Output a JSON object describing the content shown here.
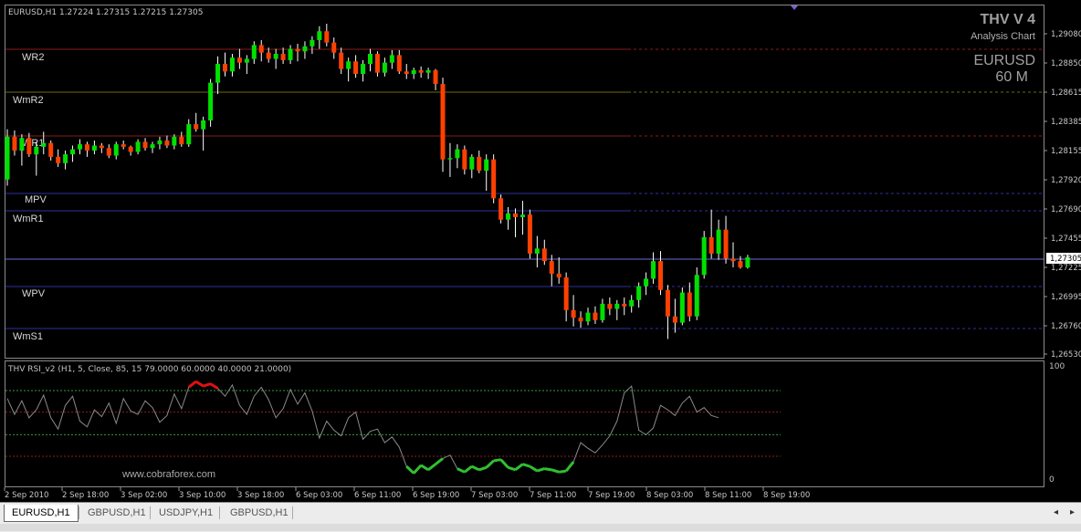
{
  "symbol_header": "EURUSD,H1  1.27224 1.27315 1.27215 1.27305",
  "brand": {
    "title": "THV V 4",
    "subtitle": "Analysis Chart",
    "symbol": "EURUSD",
    "timeframe": "60 M"
  },
  "pivot_labels": [
    "WR2",
    "WmR2",
    "WR1",
    "MPV",
    "WmR1",
    "WPV",
    "WmS1"
  ],
  "indicator": {
    "label": "THV RSI_v2  (H1,  5,  Close,  85,  15 79.0000 60.0000 40.0000 21.0000)",
    "scale_top": "100",
    "scale_bottom": "0",
    "levels": [
      79,
      60,
      40,
      21
    ],
    "watermark": "www.cobraforex.com"
  },
  "price_scale": [
    "1,29080",
    "1,28850",
    "1,28615",
    "1,28385",
    "1,28155",
    "1,27920",
    "1,27690",
    "1,27455",
    "1,27225",
    "1,26995",
    "1,26760",
    "1,26530"
  ],
  "current_price": "1,27305",
  "time_labels": [
    "2 Sep 2010",
    "2 Sep 18:00",
    "3 Sep 02:00",
    "3 Sep 10:00",
    "3 Sep 18:00",
    "6 Sep 03:00",
    "6 Sep 11:00",
    "6 Sep 19:00",
    "7 Sep 03:00",
    "7 Sep 11:00",
    "7 Sep 19:00",
    "8 Sep 03:00",
    "8 Sep 11:00",
    "8 Sep 19:00"
  ],
  "tabs": [
    {
      "label": "EURUSD,H1",
      "active": true
    },
    {
      "label": "GBPUSD,H1",
      "active": false
    },
    {
      "label": "USDJPY,H1",
      "active": false
    },
    {
      "label": "GBPUSD,H1",
      "active": false
    }
  ],
  "colors": {
    "bull": "#00e000",
    "bear": "#ff4000",
    "wick": "#ffffff",
    "axis": "#9a9a9a",
    "pivot_red": "#8b1a1a",
    "pivot_olive": "#6b6b10",
    "pivot_blue": "#3030a0",
    "rsi_line": "#8a8a8a",
    "rsi_hot": "#e01010",
    "rsi_cold": "#30c030"
  },
  "chart_data": {
    "type": "candlestick",
    "series": [
      {
        "name": "EURUSD,H1",
        "ohlc": [
          [
            1.2792,
            1.2832,
            1.2787,
            1.2826
          ],
          [
            1.2826,
            1.2831,
            1.2811,
            1.2815
          ],
          [
            1.2815,
            1.2828,
            1.2803,
            1.2825
          ],
          [
            1.2825,
            1.2829,
            1.281,
            1.2812
          ],
          [
            1.2812,
            1.2822,
            1.2795,
            1.2818
          ],
          [
            1.2818,
            1.283,
            1.2812,
            1.2821
          ],
          [
            1.2821,
            1.2823,
            1.2807,
            1.281
          ],
          [
            1.281,
            1.2816,
            1.2802,
            1.2805
          ],
          [
            1.2805,
            1.2815,
            1.28,
            1.2812
          ],
          [
            1.2812,
            1.2819,
            1.2806,
            1.2816
          ],
          [
            1.2816,
            1.2824,
            1.2812,
            1.282
          ],
          [
            1.282,
            1.2822,
            1.281,
            1.2815
          ],
          [
            1.2815,
            1.2823,
            1.2812,
            1.2819
          ],
          [
            1.2819,
            1.2821,
            1.2813,
            1.2817
          ],
          [
            1.2817,
            1.282,
            1.2809,
            1.2811
          ],
          [
            1.2811,
            1.2822,
            1.2808,
            1.282
          ],
          [
            1.282,
            1.2823,
            1.2816,
            1.2818
          ],
          [
            1.2818,
            1.2819,
            1.2811,
            1.2814
          ],
          [
            1.2814,
            1.2824,
            1.2812,
            1.2822
          ],
          [
            1.2822,
            1.2825,
            1.2815,
            1.2817
          ],
          [
            1.2817,
            1.2822,
            1.2813,
            1.282
          ],
          [
            1.282,
            1.2826,
            1.2816,
            1.2823
          ],
          [
            1.2823,
            1.2827,
            1.2817,
            1.2819
          ],
          [
            1.2819,
            1.2828,
            1.2816,
            1.2826
          ],
          [
            1.2826,
            1.283,
            1.2818,
            1.282
          ],
          [
            1.282,
            1.284,
            1.2818,
            1.2836
          ],
          [
            1.2836,
            1.2845,
            1.283,
            1.2832
          ],
          [
            1.2832,
            1.2842,
            1.2815,
            1.2839
          ],
          [
            1.2839,
            1.2872,
            1.2834,
            1.2869
          ],
          [
            1.2869,
            1.289,
            1.286,
            1.2884
          ],
          [
            1.2884,
            1.2893,
            1.2874,
            1.2878
          ],
          [
            1.2878,
            1.2892,
            1.2874,
            1.2889
          ],
          [
            1.2889,
            1.2896,
            1.288,
            1.2885
          ],
          [
            1.2885,
            1.2891,
            1.2876,
            1.2888
          ],
          [
            1.2888,
            1.2902,
            1.2884,
            1.2899
          ],
          [
            1.2899,
            1.2903,
            1.2886,
            1.2893
          ],
          [
            1.2893,
            1.2897,
            1.2885,
            1.2888
          ],
          [
            1.2888,
            1.2896,
            1.288,
            1.2892
          ],
          [
            1.2892,
            1.2897,
            1.2884,
            1.2887
          ],
          [
            1.2887,
            1.2899,
            1.2884,
            1.2896
          ],
          [
            1.2896,
            1.29,
            1.2886,
            1.2894
          ],
          [
            1.2894,
            1.2902,
            1.2888,
            1.2898
          ],
          [
            1.2898,
            1.2906,
            1.2892,
            1.2903
          ],
          [
            1.2903,
            1.2914,
            1.2896,
            1.291
          ],
          [
            1.291,
            1.2916,
            1.2898,
            1.2901
          ],
          [
            1.2901,
            1.2905,
            1.2888,
            1.2893
          ],
          [
            1.2893,
            1.2897,
            1.2876,
            1.288
          ],
          [
            1.288,
            1.2889,
            1.287,
            1.2886
          ],
          [
            1.2886,
            1.2891,
            1.2873,
            1.2876
          ],
          [
            1.2876,
            1.2887,
            1.287,
            1.2884
          ],
          [
            1.2884,
            1.2896,
            1.2878,
            1.2892
          ],
          [
            1.2892,
            1.2894,
            1.2874,
            1.2877
          ],
          [
            1.2877,
            1.2889,
            1.2874,
            1.2885
          ],
          [
            1.2885,
            1.2895,
            1.288,
            1.2891
          ],
          [
            1.2891,
            1.2895,
            1.2876,
            1.2878
          ],
          [
            1.2878,
            1.2884,
            1.2872,
            1.2876
          ],
          [
            1.2876,
            1.2881,
            1.2872,
            1.2879
          ],
          [
            1.2879,
            1.2882,
            1.2873,
            1.2877
          ],
          [
            1.2877,
            1.2881,
            1.2872,
            1.2879
          ],
          [
            1.2879,
            1.288,
            1.2863,
            1.2868
          ],
          [
            1.2868,
            1.2873,
            1.2798,
            1.2808
          ],
          [
            1.2808,
            1.2821,
            1.2794,
            1.2809
          ],
          [
            1.2809,
            1.282,
            1.2801,
            1.2816
          ],
          [
            1.2816,
            1.2819,
            1.2796,
            1.28
          ],
          [
            1.28,
            1.2812,
            1.2793,
            1.281
          ],
          [
            1.281,
            1.2815,
            1.2797,
            1.2799
          ],
          [
            1.2799,
            1.2812,
            1.2783,
            1.2808
          ],
          [
            1.2808,
            1.2812,
            1.2773,
            1.2777
          ],
          [
            1.2777,
            1.278,
            1.2757,
            1.276
          ],
          [
            1.276,
            1.277,
            1.2752,
            1.2765
          ],
          [
            1.2765,
            1.2769,
            1.2746,
            1.2762
          ],
          [
            1.2762,
            1.2775,
            1.2748,
            1.2764
          ],
          [
            1.2764,
            1.2768,
            1.2729,
            1.2733
          ],
          [
            1.2733,
            1.2747,
            1.2722,
            1.2737
          ],
          [
            1.2737,
            1.2744,
            1.2724,
            1.2727
          ],
          [
            1.2727,
            1.2732,
            1.2707,
            1.2717
          ],
          [
            1.2717,
            1.273,
            1.2709,
            1.2714
          ],
          [
            1.2714,
            1.2718,
            1.2679,
            1.2688
          ],
          [
            1.2688,
            1.27,
            1.2675,
            1.2682
          ],
          [
            1.2682,
            1.2687,
            1.2674,
            1.2679
          ],
          [
            1.2679,
            1.269,
            1.2676,
            1.2686
          ],
          [
            1.2686,
            1.2691,
            1.2677,
            1.268
          ],
          [
            1.268,
            1.2697,
            1.2678,
            1.2693
          ],
          [
            1.2693,
            1.2698,
            1.2684,
            1.2689
          ],
          [
            1.2689,
            1.2696,
            1.268,
            1.2693
          ],
          [
            1.2693,
            1.2698,
            1.2684,
            1.2691
          ],
          [
            1.2691,
            1.27,
            1.2686,
            1.2696
          ],
          [
            1.2696,
            1.271,
            1.269,
            1.2707
          ],
          [
            1.2707,
            1.2718,
            1.27,
            1.2713
          ],
          [
            1.2713,
            1.2734,
            1.2709,
            1.2727
          ],
          [
            1.2727,
            1.2735,
            1.27,
            1.2704
          ],
          [
            1.2704,
            1.2708,
            1.2665,
            1.2683
          ],
          [
            1.2683,
            1.2697,
            1.267,
            1.2678
          ],
          [
            1.2678,
            1.2706,
            1.2676,
            1.2702
          ],
          [
            1.2702,
            1.271,
            1.2679,
            1.2683
          ],
          [
            1.2683,
            1.2722,
            1.268,
            1.2716
          ],
          [
            1.2716,
            1.2751,
            1.2713,
            1.2746
          ],
          [
            1.2746,
            1.2768,
            1.2729,
            1.2733
          ],
          [
            1.2733,
            1.276,
            1.2728,
            1.2752
          ],
          [
            1.2752,
            1.2763,
            1.2725,
            1.2729
          ],
          [
            1.2729,
            1.2742,
            1.2722,
            1.2727
          ],
          [
            1.2727,
            1.2731,
            1.2721,
            1.2722
          ],
          [
            1.2722,
            1.2732,
            1.2721,
            1.273
          ]
        ]
      },
      {
        "name": "THV RSI_v2",
        "values": [
          72,
          58,
          70,
          55,
          62,
          75,
          55,
          45,
          66,
          74,
          52,
          47,
          62,
          56,
          68,
          50,
          72,
          61,
          58,
          70,
          64,
          51,
          57,
          76,
          63,
          82,
          87,
          83,
          85,
          81,
          74,
          84,
          66,
          58,
          74,
          82,
          71,
          55,
          63,
          80,
          67,
          77,
          61,
          37,
          52,
          44,
          39,
          55,
          60,
          36,
          43,
          45,
          33,
          38,
          29,
          12,
          6,
          13,
          9,
          14,
          19,
          22,
          10,
          7,
          12,
          9,
          11,
          17,
          18,
          11,
          9,
          14,
          12,
          8,
          10,
          9,
          7,
          8,
          16,
          33,
          28,
          24,
          31,
          39,
          52,
          77,
          83,
          44,
          40,
          46,
          66,
          62,
          57,
          68,
          74,
          60,
          64,
          57,
          55
        ]
      }
    ]
  }
}
